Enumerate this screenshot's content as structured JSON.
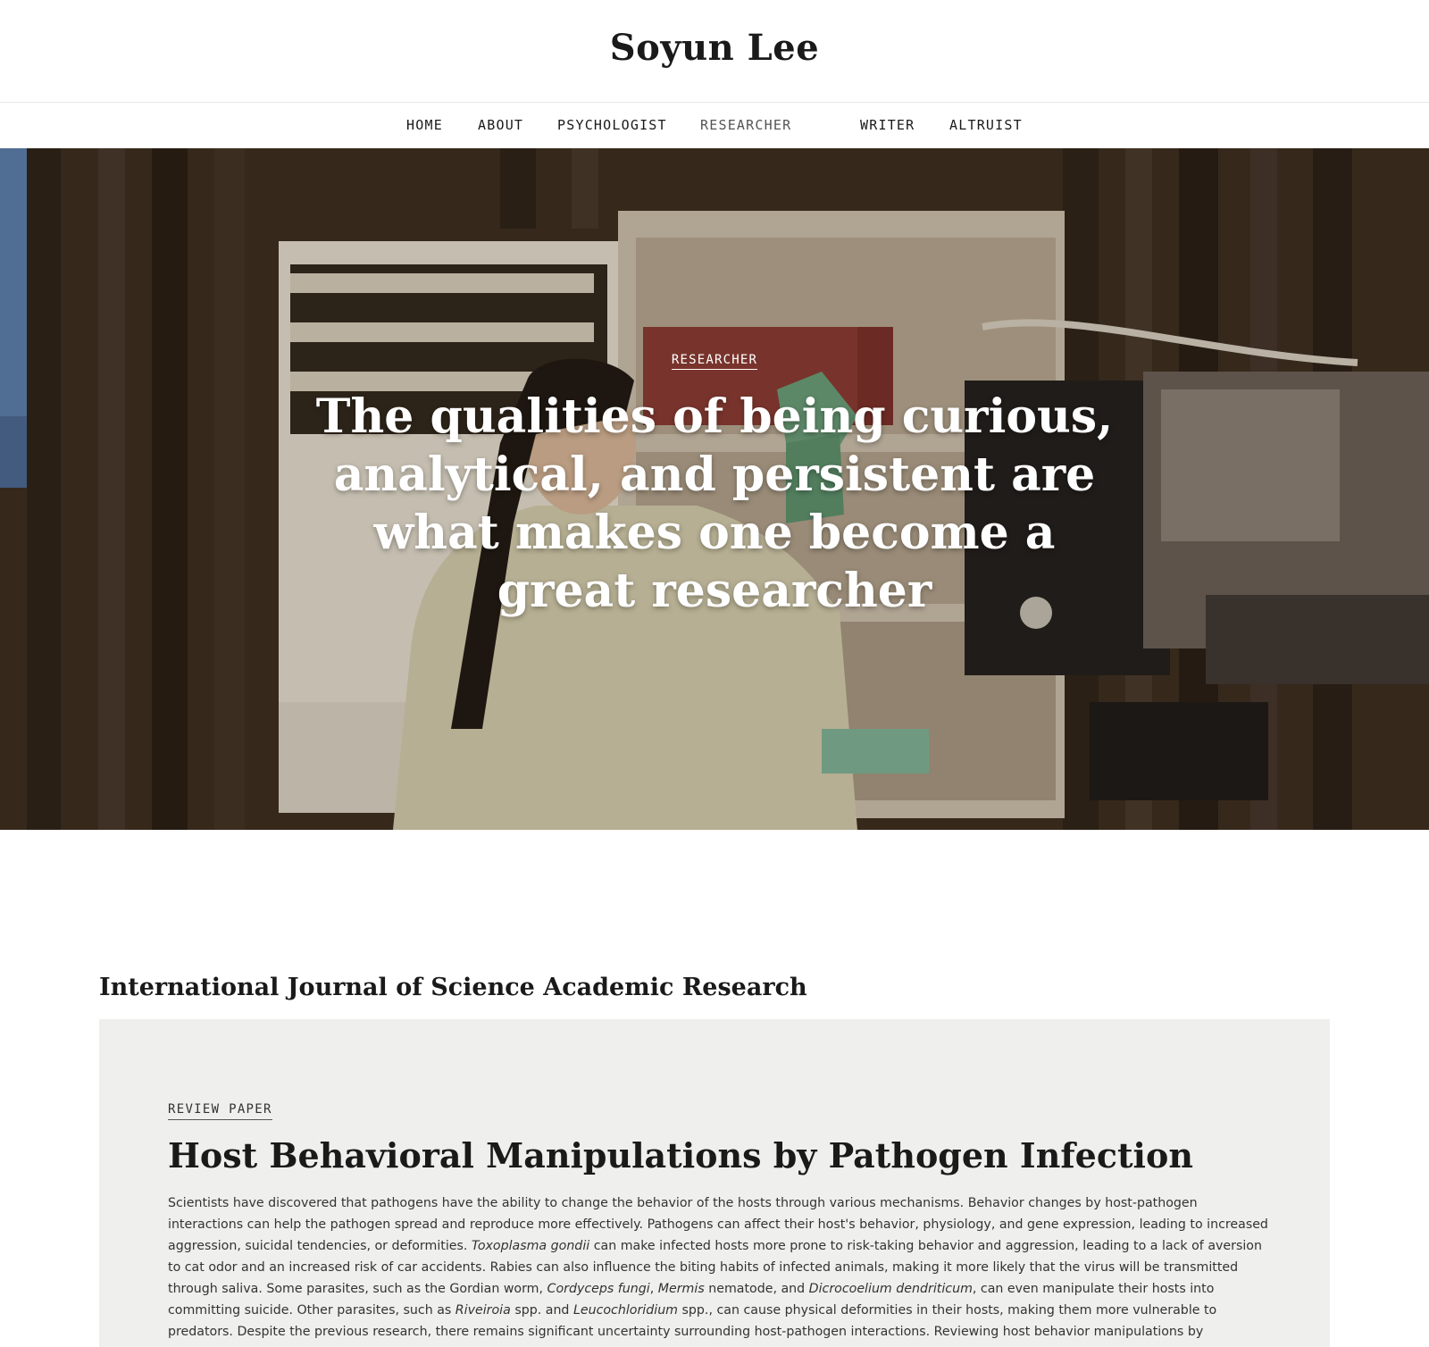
{
  "site": {
    "title": "Soyun Lee"
  },
  "nav": {
    "items": [
      {
        "label": "HOME"
      },
      {
        "label": "ABOUT"
      },
      {
        "label": "PSYCHOLOGIST"
      },
      {
        "label": "RESEARCHER"
      },
      {
        "label": "WRITER"
      },
      {
        "label": "ALTRUIST"
      }
    ],
    "current": "RESEARCHER"
  },
  "hero": {
    "tag": "RESEARCHER",
    "quote": "The qualities of being curious, analytical, and persistent are what makes one become a great researcher",
    "photo_alt": "Researcher in a lab coat and green gloves adjusting a microscope apparatus"
  },
  "section": {
    "heading": "International Journal of Science Academic Research"
  },
  "paper": {
    "tag": "REVIEW PAPER",
    "title": "Host Behavioral Manipulations by Pathogen Infection",
    "body": [
      {
        "t": "Scientists have discovered that pathogens have the ability to change the behavior of the hosts through various mechanisms. Behavior changes by host-pathogen interactions can help the pathogen spread and reproduce more effectively. Pathogens can affect their host's behavior, physiology, and gene expression, leading to increased aggression, suicidal tendencies, or deformities. "
      },
      {
        "t": "Toxoplasma gondii",
        "i": true
      },
      {
        "t": " can make infected hosts more prone to risk-taking behavior and aggression, leading to a lack of aversion to cat odor and an increased risk of car accidents. Rabies can also influence the biting habits of infected animals, making it more likely that the virus will be transmitted through saliva. Some parasites, such as the Gordian worm, "
      },
      {
        "t": "Cordyceps fungi",
        "i": true
      },
      {
        "t": ", "
      },
      {
        "t": "Mermis",
        "i": true
      },
      {
        "t": " nematode, and "
      },
      {
        "t": "Dicrocoelium dendriticum",
        "i": true
      },
      {
        "t": ", can even manipulate their hosts into committing suicide. Other parasites, such as "
      },
      {
        "t": "Riveiroia",
        "i": true
      },
      {
        "t": " spp. and "
      },
      {
        "t": "Leucochloridium",
        "i": true
      },
      {
        "t": " spp., can cause physical deformities in their hosts, making them more vulnerable to predators. Despite the previous research, there remains significant uncertainty surrounding host-pathogen interactions. Reviewing host behavior manipulations by pathogens is a critical and fascinating medical area of study for both humans and animals."
      }
    ]
  },
  "colors": {
    "card_bg": "#efefed",
    "text": "#1a1a1a",
    "glove": "#5fa07a"
  }
}
